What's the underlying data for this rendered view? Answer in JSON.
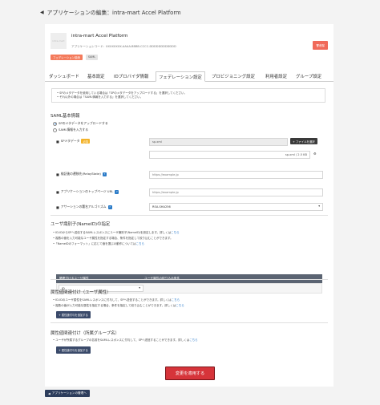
{
  "header": {
    "back_arrow": "◀",
    "title": "アプリケーションの編集：intra-mart Accel Platform"
  },
  "app": {
    "thumbnail_text": "intra-mart",
    "name": "intra-mart Accel Platform",
    "code_line": "アプリケーションコード：XXXXXXXX-AAAA-BBBB-CCCC-DDDDDDDDDDDD",
    "badge_federation": "フェデレーション接続",
    "badge_saml": "SAML",
    "delete_label": "削除"
  },
  "tabs": [
    {
      "label": "ダッシュボード"
    },
    {
      "label": "基本設定"
    },
    {
      "label": "IDプロバイダ情報"
    },
    {
      "label": "フェデレーション設定"
    },
    {
      "label": "プロビジョニング設定"
    },
    {
      "label": "利用者設定"
    },
    {
      "label": "グループ設定"
    }
  ],
  "notice": {
    "line1": "• SPのメタデータを使用している場合は「SPのメタデータをアップロードする」を選択してください。",
    "line2": "• それ以外の場合は「SAML情報を入力する」を選択してください。"
  },
  "saml_basic": {
    "title": "SAML基本情報",
    "radio_upload": "SPのメタデータをアップロードする",
    "radio_input": "SAML情報を入力する",
    "metadata_label": "SPメタデータ",
    "required_tag": "必須",
    "metadata_file": "sp.xml",
    "file_select_label": "ファイルを選択",
    "file_info": "sp.xml / 2.5 KB",
    "relay_label": "検証後の遷移先(RelayState)",
    "relay_placeholder": "https://example.jp",
    "top_url_label": "アプリケーションのトップページ URL",
    "top_url_placeholder": "https://example.jp",
    "sig_label": "アサーションの署名アルゴリズム",
    "sig_value": "RSA-SHA256"
  },
  "nameid": {
    "title": "ユーザ識別子(NameID)の指定",
    "line1_pre": "• ID-IDからSPへ送信するSAMLレスポンスにユーザ識別子(NameID)を設定します。詳しくは",
    "line2": "• 複数の値を入力可能なユーザ属性を指定する場合、条件を指定して絞り込むことができます。",
    "line3_pre": "•「NameIDのフォーマット」に応じて値を選ぶ",
    "line3_mid": "の動作については",
    "link_here": "こちら",
    "col_attr": "関連付けるユーザ属性",
    "col_filter": "ユーザ属性の絞り込み条件",
    "row_attr": "ID"
  },
  "attr_user": {
    "title": "属性値関連付け（ユーザ属性）",
    "line1_pre": "• ID-IDのユーザ属性をSAMLレスポンスに付与して、SPへ送信することができます。詳しくは",
    "line2_pre": "• 複数の値が入力可能な属性を指定する場合、条件を指定して絞り込むことができます。詳しくは",
    "link_here": "こちら",
    "add_label": "属性値付与を追加する"
  },
  "attr_group": {
    "title": "属性値関連付け（所属グループ名）",
    "line1_pre": "• ユーザが所属するグループの名前をSAMLレスポンスに付与して、SPへ送信することができます。詳しくは",
    "link_here": "こちら",
    "add_label": "属性値付与を追加する"
  },
  "apply_label": "変更を適用する",
  "back_label": "アプリケーションの管理へ",
  "colors": {
    "accent": "#1e73c8",
    "danger": "#d6343a",
    "dark_button": "#2d3d5c",
    "table_header": "#5b6472"
  }
}
